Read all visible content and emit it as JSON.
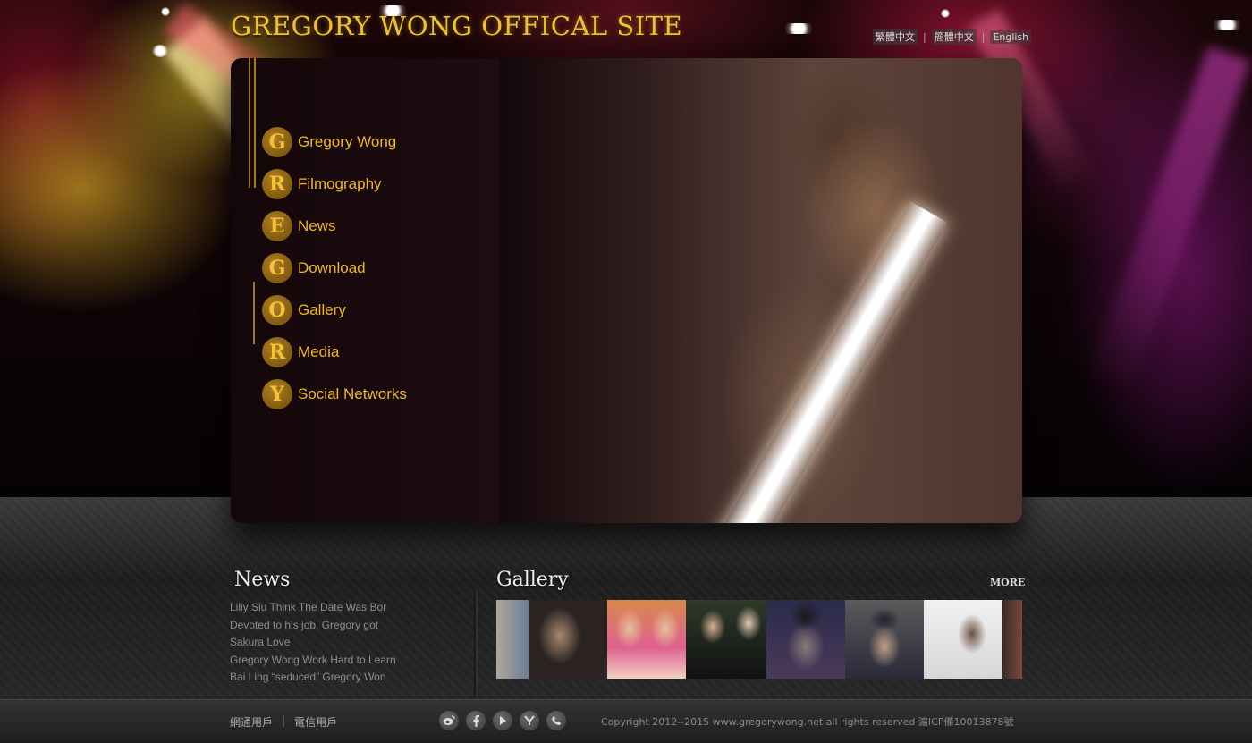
{
  "header": {
    "title": "GREGORY WONG OFFICAL SITE",
    "languages": [
      "繁體中文",
      "簡體中文",
      "English"
    ]
  },
  "nav": [
    {
      "letter": "G",
      "label": "Gregory Wong"
    },
    {
      "letter": "R",
      "label": "Filmography"
    },
    {
      "letter": "E",
      "label": "News"
    },
    {
      "letter": "G",
      "label": "Download"
    },
    {
      "letter": "O",
      "label": "Gallery"
    },
    {
      "letter": "R",
      "label": "Media"
    },
    {
      "letter": "Y",
      "label": "Social Networks"
    }
  ],
  "news": {
    "title": "News",
    "items": [
      "Liliy Siu Think The Date Was Bor",
      "Devoted to his job, Gregory got",
      "Sakura Love",
      "Gregory Wong Work Hard to Learn",
      "Bai Ling “seduced” Gregory Won"
    ]
  },
  "gallery": {
    "title": "Gallery",
    "more_label": "MORE"
  },
  "footer": {
    "links": [
      "網通用戶",
      "電信用戶"
    ],
    "social_icons": [
      "weibo-icon",
      "facebook-icon",
      "youtube-icon",
      "yahoo-icon",
      "phone-icon"
    ],
    "copyright": "Copyright 2012--2015 www.gregorywong.net all rights reserved 滬ICP備10013878號"
  },
  "colors": {
    "accent": "#f0b820",
    "title_gold": "#f0c030"
  }
}
